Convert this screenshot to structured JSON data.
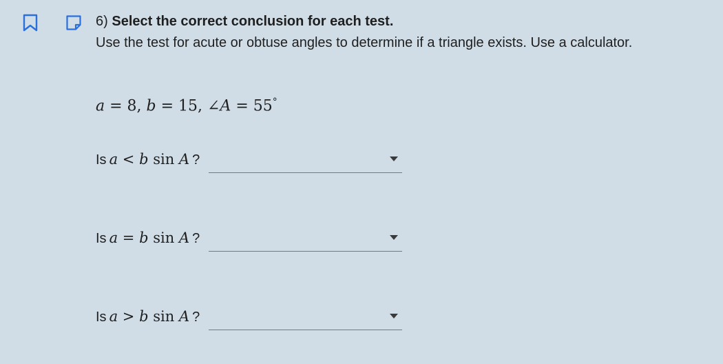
{
  "question": {
    "number": "6)",
    "title": "Select the correct conclusion for each test.",
    "instructions": "Use the test for acute or obtuse angles to determine if a triangle exists. Use a calculator."
  },
  "given": {
    "a_var": "a",
    "a_eq": " = 8, ",
    "b_var": "b",
    "b_eq": " = 15, ",
    "angle_symbol": "∠",
    "angle_var": "A",
    "angle_eq": " = 55",
    "degree": "°"
  },
  "tests": [
    {
      "prefix": "Is",
      "lhs": "a",
      "op": "<",
      "rhs_b": "b",
      "sin": "sin",
      "rhs_a": "A",
      "suffix": "?",
      "selected": ""
    },
    {
      "prefix": "Is",
      "lhs": "a",
      "op": "=",
      "rhs_b": "b",
      "sin": "sin",
      "rhs_a": "A",
      "suffix": "?",
      "selected": ""
    },
    {
      "prefix": "Is",
      "lhs": "a",
      "op": ">",
      "rhs_b": "b",
      "sin": "sin",
      "rhs_a": "A",
      "suffix": "?",
      "selected": ""
    }
  ],
  "icons": {
    "bookmark": "bookmark-icon",
    "note": "note-icon",
    "caret": "chevron-down-icon"
  },
  "colors": {
    "background": "#d0dde6",
    "accent": "#2a6fdb",
    "underline": "#6f7a84"
  }
}
